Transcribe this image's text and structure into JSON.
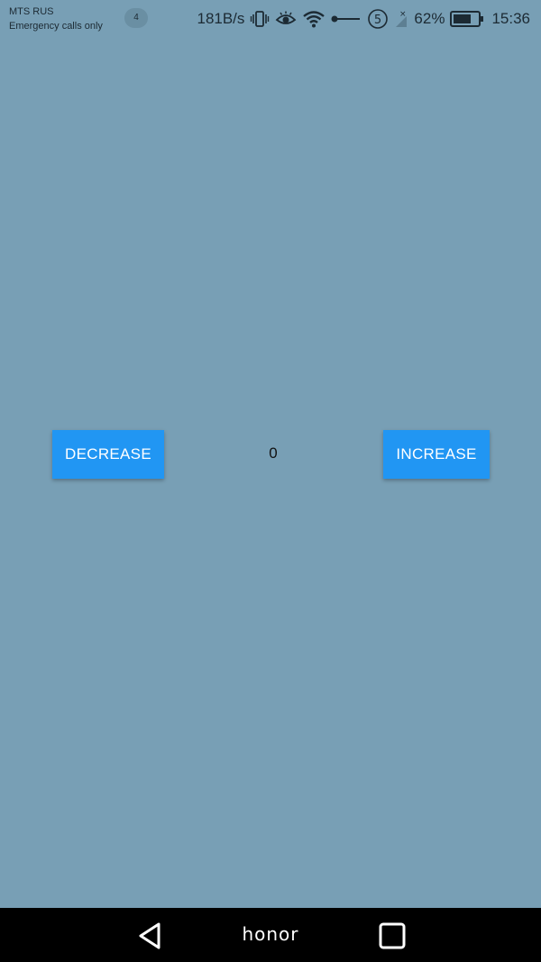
{
  "status_bar": {
    "carrier": "MTS RUS",
    "carrier_sub": "Emergency calls only",
    "notification_count": "4",
    "net_speed": "181B/s",
    "battery_percent": "62%",
    "time": "15:36",
    "icons": [
      "vibrate-icon",
      "eye-icon",
      "wifi-icon",
      "key-icon",
      "sync-icon",
      "no-signal-icon",
      "battery-icon"
    ]
  },
  "main": {
    "decrease_label": "DECREASE",
    "counter": "0",
    "increase_label": "INCREASE",
    "background_color": "#789fb5",
    "button_color": "#2196f3"
  },
  "nav_bar": {
    "brand": "honor",
    "icons": [
      "back-icon",
      "recents-icon"
    ]
  }
}
